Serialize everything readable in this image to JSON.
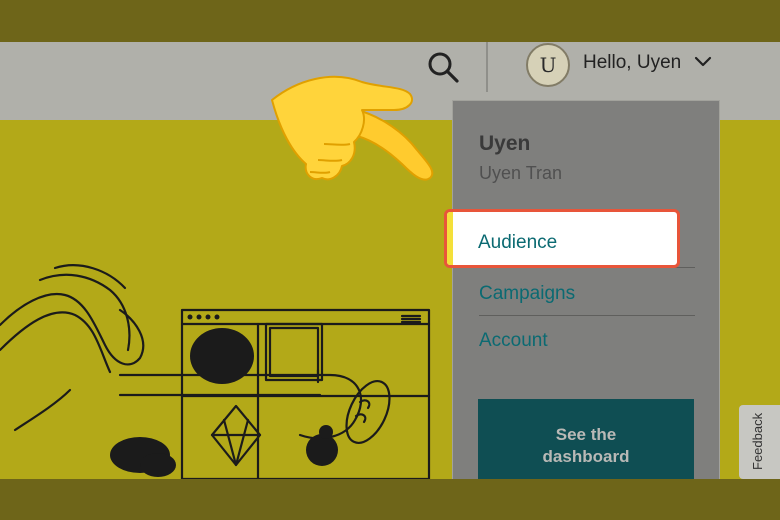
{
  "colors": {
    "frame": "#6e6519",
    "header": "#b0b0aa",
    "hero": "#b3a918",
    "dropdown": "#7f7f7d",
    "link": "#0b6a72",
    "highlight_border": "#e8553a",
    "cta": "#0f4e53"
  },
  "header": {
    "search_icon": "search-icon",
    "avatar_initial": "U",
    "greeting": "Hello, Uyen",
    "chevron_icon": "chevron-down-icon"
  },
  "dropdown": {
    "name": "Uyen",
    "full_name": "Uyen Tran",
    "items": [
      {
        "label": "Audience",
        "highlighted": true
      },
      {
        "label": "Campaigns"
      },
      {
        "label": "Account"
      }
    ],
    "cta_line1": "See the",
    "cta_line2": "dashboard"
  },
  "feedback": {
    "label": "Feedback"
  },
  "annotation": {
    "pointer_icon": "pointing-hand-emoji"
  }
}
